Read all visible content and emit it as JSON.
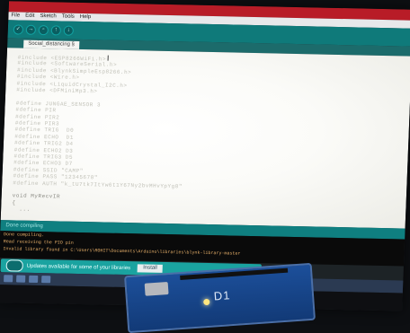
{
  "menubar": [
    "File",
    "Edit",
    "Sketch",
    "Tools",
    "Help"
  ],
  "toolbar": {
    "buttons": [
      "verify",
      "upload",
      "new",
      "open",
      "save"
    ]
  },
  "tab": {
    "label": "Social_distancing §"
  },
  "editor": {
    "code_lines": [
      "#include <ESP8266WiFi.h>",
      "#include <SoftwareSerial.h>",
      "#include <BlynkSimpleEsp8266.h>",
      "#include <Wire.h>",
      "#include <LiquidCrystal_I2C.h>",
      "#include <DFMiniMp3.h>",
      "",
      "#define JUNGAE_SENSOR 3",
      "#define PIR   ",
      "#define PIR2  ",
      "#define PIR3  ",
      "#define TRIG  D0",
      "#define ECHO  D1",
      "#define TRIG2 D4",
      "#define ECHO2 D3",
      "#define TRIG3 D5",
      "#define ECHO3 D7",
      "#define SSID \"CAMP\"",
      "#define PASS \"12345678\"",
      "#define AUTH \"k_tU7tk7ItYw6t1Y67Ny2bvMHvYpYg8\"",
      "",
      "void MyRecvIR",
      "{",
      "  ..."
    ]
  },
  "console": {
    "header": "Done compiling",
    "lines": [
      "Done compiling.",
      "Read receiving the PIO pin",
      "Invalid library found in C:\\Users\\ROHIT\\Documents\\Arduino\\libraries\\blynk-library-master"
    ]
  },
  "notification": {
    "message": "Updates available for some of your libraries",
    "button": "Install"
  },
  "board": {
    "label": "D1"
  }
}
